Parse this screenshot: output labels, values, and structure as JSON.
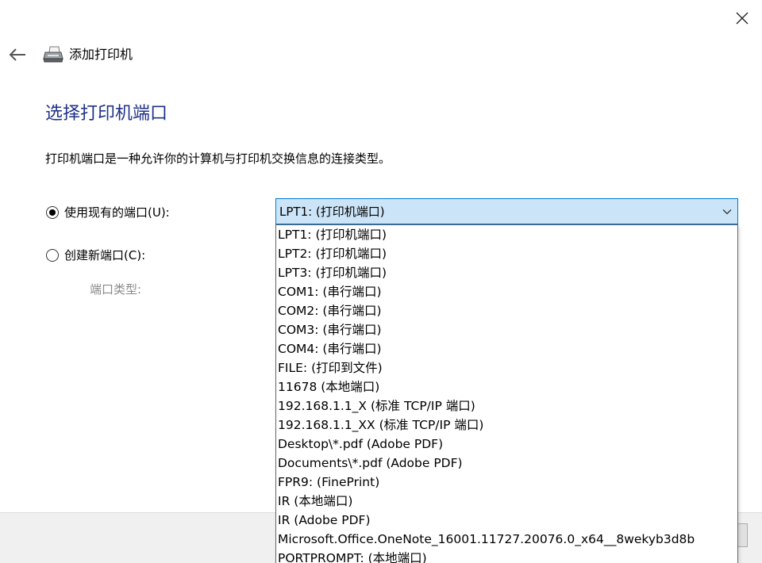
{
  "window": {
    "title": "添加打印机"
  },
  "page": {
    "heading": "选择打印机端口",
    "description": "打印机端口是一种允许你的计算机与打印机交换信息的连接类型。"
  },
  "options": {
    "use_existing": {
      "label": "使用现有的端口(U):",
      "selected": true
    },
    "create_new": {
      "label": "创建新端口(C):",
      "selected": false
    },
    "port_type_label": "端口类型:"
  },
  "port_select": {
    "selected": "LPT1: (打印机端口)",
    "options": [
      "LPT1: (打印机端口)",
      "LPT2: (打印机端口)",
      "LPT3: (打印机端口)",
      "COM1: (串行端口)",
      "COM2: (串行端口)",
      "COM3: (串行端口)",
      "COM4: (串行端口)",
      "FILE: (打印到文件)",
      "11678 (本地端口)",
      "192.168.1.1_X (标准 TCP/IP 端口)",
      "192.168.1.1_XX (标准 TCP/IP 端口)",
      "Desktop\\*.pdf (Adobe PDF)",
      "Documents\\*.pdf (Adobe PDF)",
      "FPR9: (FinePrint)",
      "IR (本地端口)",
      "IR (Adobe PDF)",
      "Microsoft.Office.OneNote_16001.11727.20076.0_x64__8wekyb3d8b",
      "PORTPROMPT: (本地端口)"
    ]
  },
  "icons": {
    "close": "close-icon",
    "back": "back-arrow-icon",
    "printer": "printer-icon",
    "dropdown": "chevron-down-icon"
  },
  "colors": {
    "heading": "#1e3287",
    "combo_selected_bg": "#cce4f7",
    "combo_border": "#0078d7"
  }
}
